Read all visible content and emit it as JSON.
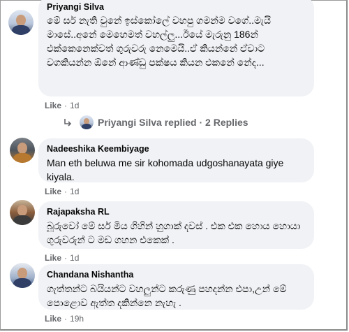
{
  "comments": [
    {
      "author": "Priyangi Silva",
      "text": "මේ සර් නැති වුනේ ඉස්කෝලේ වහපු ගමන්ම වගේ..මැයි මාසේ..අනේ මෙහෙමත් වහල්ලු...ඊයේ මැරුනු 186න් එක්කෙනෙක්වත් ගුරුවරු නෙමෙයි..ඒ කියන්නේ ඒවාට වගකියන්න ඕනේ ආණ්ඩු පක්ෂය කියන එකනේ නේද...",
      "like_label": "Like",
      "time": "1d"
    },
    {
      "author": "Nadeeshika Keembiyage",
      "text": "Man eth beluwa me sir kohomada udgoshanayata giye kiyala.",
      "like_label": "Like",
      "time": "1d"
    },
    {
      "author": "Rajapaksha RL",
      "text": "බූරුවෝ මේ සර් මිය ගිහින් හුගාක් දවස් . එක එක හොය හොයා ගුරුවරුන් ට මඩ ගහන එකෙක් .",
      "like_label": "Like",
      "time": "1d"
    },
    {
      "author": "Chandana Nishantha",
      "text": "ගැත්තන්ට බයියන්ට වහලුන්ට කරුණු පහදන්න එපා,උන් මේ පොළොව ඇත්ත දකින්නෙ නැහැ .",
      "like_label": "Like",
      "time": "19h"
    }
  ],
  "replies": {
    "author": "Priyangi Silva",
    "label": "Priyangi Silva replied · 2 Replies"
  },
  "colors": {
    "bubble": "#f0f2f5",
    "meta": "#65676b",
    "text": "#050505"
  },
  "icons": [
    "reply-arrow-icon"
  ]
}
